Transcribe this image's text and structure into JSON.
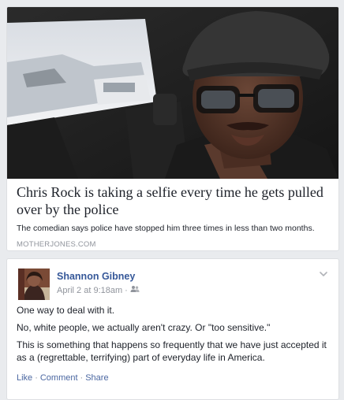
{
  "link_preview": {
    "title": "Chris Rock is taking a selfie every time he gets pulled over by the police",
    "description": "The comedian says police have stopped him three times in less than two months.",
    "domain": "MOTHERJONES.COM"
  },
  "post": {
    "author": "Shannon Gibney",
    "timestamp": "April 2 at 9:18am",
    "meta_separator": "·",
    "audience_icon": "friends-icon",
    "paragraphs": [
      "One way to deal with it.",
      "No, white people, we actually aren't crazy. Or \"too sensitive.\"",
      "This is something that happens so frequently that we have just accepted it as a (regrettable, terrifying) part of everyday life in America."
    ],
    "actions": {
      "like": "Like",
      "comment": "Comment",
      "share": "Share",
      "separator": "·"
    }
  },
  "colors": {
    "link_blue": "#365899",
    "action_blue": "#4b67a1",
    "meta_gray": "#90949c",
    "text": "#1d2129"
  }
}
